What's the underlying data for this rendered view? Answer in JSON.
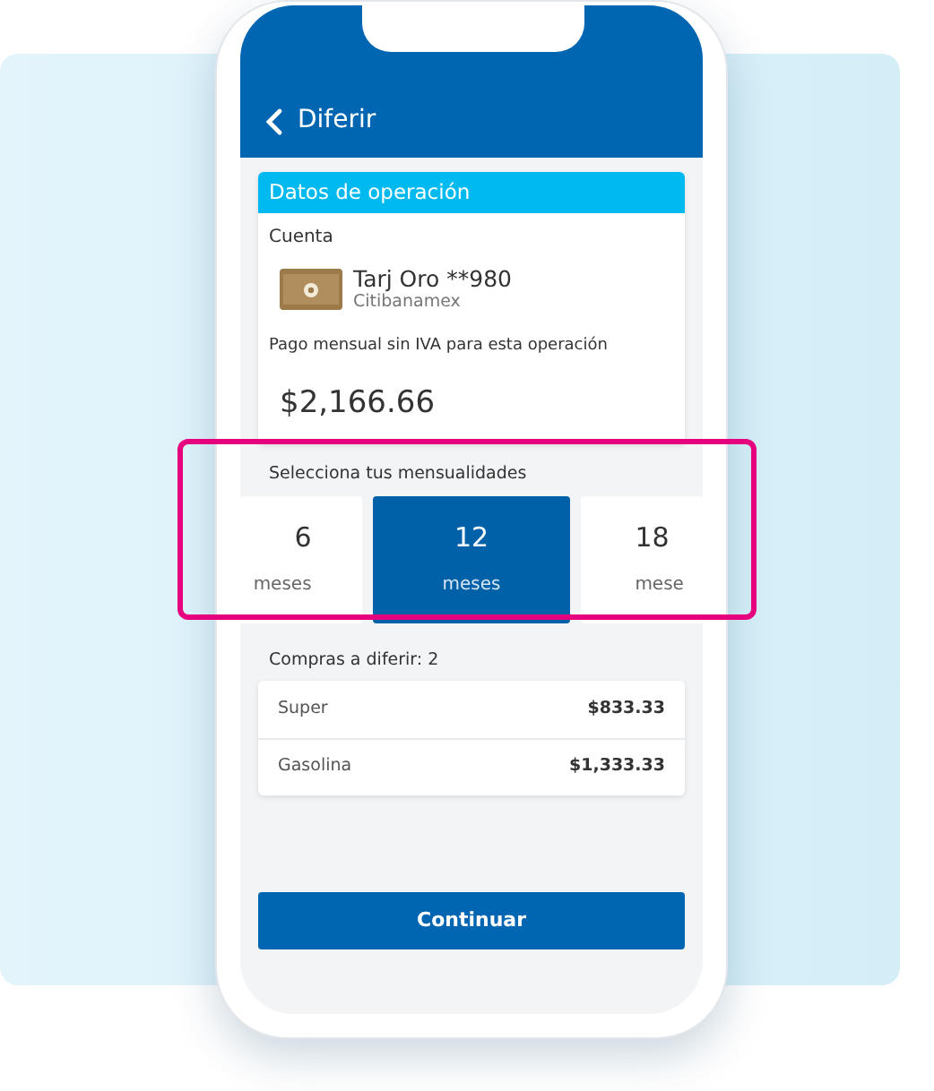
{
  "header": {
    "title": "Diferir"
  },
  "operation": {
    "title": "Datos de operación",
    "account_label": "Cuenta",
    "card_name": "Tarj Oro **980",
    "bank": "Citibanamex",
    "payment_label": "Pago mensual sin IVA para esta operación",
    "amount": "$2,166.66"
  },
  "installments": {
    "label": "Selecciona tus mensualidades",
    "options": [
      {
        "number": "6",
        "unit": "meses",
        "selected": false,
        "kind": "left"
      },
      {
        "number": "12",
        "unit": "meses",
        "selected": true,
        "kind": "full"
      },
      {
        "number": "18",
        "unit": "mese",
        "selected": false,
        "kind": "right"
      }
    ]
  },
  "purchases": {
    "label": "Compras a diferir: 2",
    "items": [
      {
        "name": "Super",
        "amount": "$833.33"
      },
      {
        "name": "Gasolina",
        "amount": "$1,333.33"
      }
    ]
  },
  "button": "Continuar"
}
